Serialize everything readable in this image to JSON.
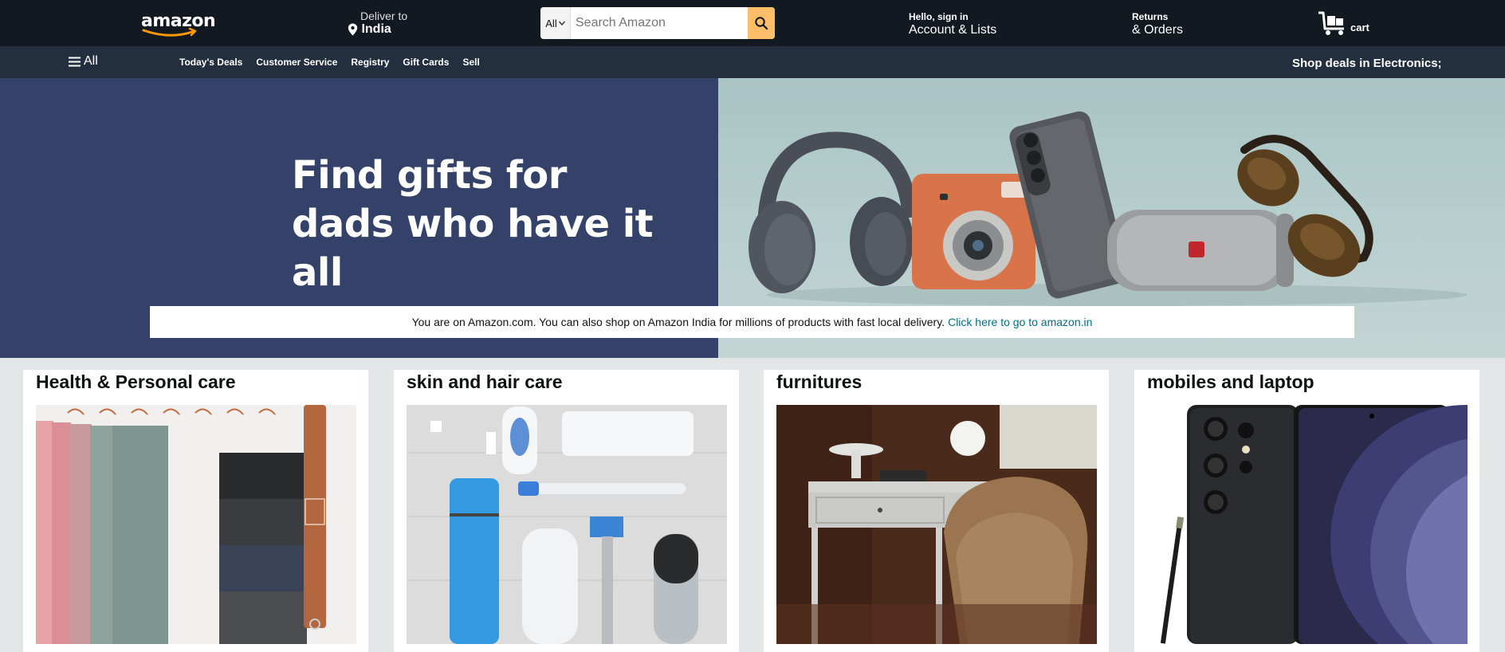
{
  "header": {
    "logo": "amazon",
    "deliver_to_label": "Deliver to",
    "deliver_to_location": "India",
    "search": {
      "category": "All",
      "placeholder": "Search Amazon"
    },
    "account": {
      "line1": "Hello, sign in",
      "line2": "Account & Lists"
    },
    "returns": {
      "line1": "Returns",
      "line2": "& Orders"
    },
    "cart_label": "cart"
  },
  "subnav": {
    "all_label": "All",
    "items": [
      "Today's Deals",
      "Customer Service",
      "Registry",
      "Gift Cards",
      "Sell"
    ],
    "promo": "Shop deals in Electronics;"
  },
  "hero": {
    "headline_line1": "Find gifts for",
    "headline_line2": "dads who have it all",
    "notice_text": "You are on Amazon.com. You can also shop on Amazon India for millions of products with fast local delivery.",
    "notice_link": "Click here to go to amazon.in"
  },
  "cards": [
    {
      "title": "Health & Personal care"
    },
    {
      "title": "skin and hair care"
    },
    {
      "title": "furnitures"
    },
    {
      "title": "mobiles and laptop"
    }
  ],
  "colors": {
    "nav_bg": "#131921",
    "subnav_bg": "#232f3e",
    "search_button": "#febd69",
    "hero_left": "#34426a",
    "link": "#007185",
    "page_bg": "#e3e6e6"
  }
}
